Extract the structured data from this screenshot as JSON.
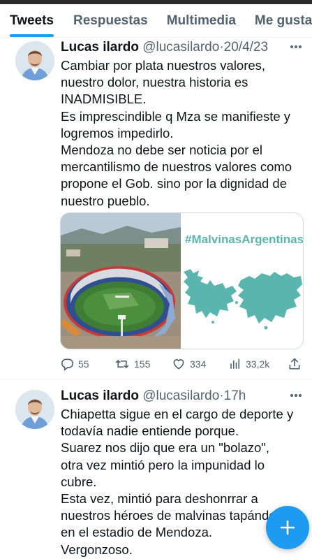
{
  "tabs": [
    {
      "label": "Tweets",
      "active": true
    },
    {
      "label": "Respuestas",
      "active": false
    },
    {
      "label": "Multimedia",
      "active": false
    },
    {
      "label": "Me gusta",
      "active": false
    }
  ],
  "colors": {
    "accent": "#1d9bf0",
    "muted": "#536471",
    "text": "#0f1419",
    "map": "#5ab5ae"
  },
  "tweets": [
    {
      "author": "Lucas ilardo",
      "handle": "@lucasilardo",
      "separator": "·",
      "time": "20/4/23",
      "lines": [
        "Cambiar por plata nuestros valores,",
        "nuestro dolor, nuestra historia es",
        "INADMISIBLE.",
        "Es imprescindible q Mza se manifieste y",
        "logremos impedirlo.",
        "Mendoza no debe ser noticia por el",
        "mercantilismo de nuestros valores como",
        "propone el Gob. sino por la dignidad de",
        "nuestro pueblo."
      ],
      "media": {
        "hashtag": "#MalvinasArgentinas",
        "left_image": "stadium-aerial-photo",
        "right_image": "malvinas-islands-map"
      },
      "stats": {
        "replies": "55",
        "retweets": "155",
        "likes": "334",
        "views": "33,2k"
      }
    },
    {
      "author": "Lucas ilardo",
      "handle": "@lucasilardo",
      "separator": "·",
      "time": "17h",
      "lines": [
        "Chiapetta sigue en el cargo de deporte y",
        "todavía nadie entiende porque.",
        "Suarez nos dijo que era un \"bolazo\",",
        "otra vez mintió pero la impunidad lo",
        "cubre.",
        "Esta vez, mintió para deshonrrar a",
        "nuestros héroes de malvinas tapándo",
        "en el estadio de Mendoza.",
        "Vergonzoso."
      ]
    }
  ],
  "fab": {
    "icon": "plus-icon"
  }
}
